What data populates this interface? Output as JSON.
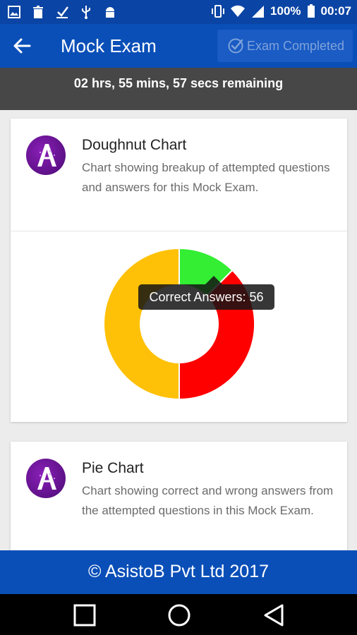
{
  "status_bar": {
    "battery": "100%",
    "time": "00:07",
    "left_icons": [
      "image-icon",
      "trash-icon",
      "download-icon",
      "usb-icon",
      "android-icon"
    ],
    "right_icons": [
      "vibrate-icon",
      "wifi-icon",
      "signal-icon",
      "battery-icon"
    ]
  },
  "appbar": {
    "title": "Mock Exam",
    "back_icon": "arrow-left-icon",
    "exam_button_label": "Exam Completed",
    "exam_button_icon": "check-circle-icon"
  },
  "timer": {
    "text": "02 hrs, 55 mins, 57 secs remaining"
  },
  "cards": [
    {
      "title": "Doughnut Chart",
      "subtitle": "Chart showing breakup of attempted questions and answers for this Mock Exam.",
      "avatar_icon": "asistob-logo-icon"
    },
    {
      "title": "Pie Chart",
      "subtitle": "Chart showing correct and wrong answers from the attempted questions in this Mock Exam.",
      "avatar_icon": "asistob-logo-icon"
    }
  ],
  "chart_data": {
    "type": "pie",
    "variant": "doughnut",
    "slices": [
      {
        "label": "Correct Answers",
        "value": 56,
        "color": "#33ee33"
      },
      {
        "label": "",
        "value": 169,
        "color": "#ff0000"
      },
      {
        "label": "",
        "value": 225,
        "color": "#ffc107"
      }
    ],
    "tooltip": "Correct Answers: 56"
  },
  "footer": {
    "text": "© AsistoB Pvt Ltd 2017"
  },
  "navbar": {
    "icons": [
      "square-recent-icon",
      "circle-home-icon",
      "triangle-back-icon"
    ]
  },
  "colors": {
    "primary": "#0a4fb8",
    "status_bar": "#0a44a4",
    "timer_bg": "#474747"
  }
}
